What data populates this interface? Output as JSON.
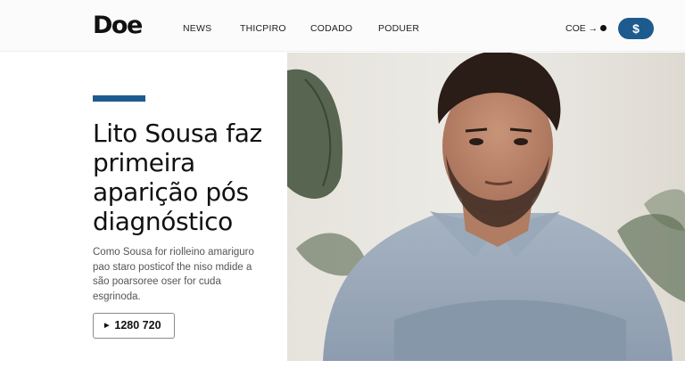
{
  "header": {
    "logo": "Doe",
    "nav": [
      "NEWS",
      "THICPIRO",
      "CODADO",
      "PODUER"
    ],
    "account_label": "COE →",
    "action_button": "$"
  },
  "article": {
    "headline": "Lito Sousa faz primeira aparição pós diagnóstico",
    "summary": "Como Sousa for riolleino amariguro pao staro posticof the niso mdide a são poarsoree oser for cuda esgrinoda.",
    "cta_label": "1280 720"
  },
  "colors": {
    "accent": "#1d5b8f",
    "text": "#111111",
    "muted": "#555555"
  },
  "icons": {
    "cta": "play-triangle-icon",
    "account": "dot-icon"
  }
}
